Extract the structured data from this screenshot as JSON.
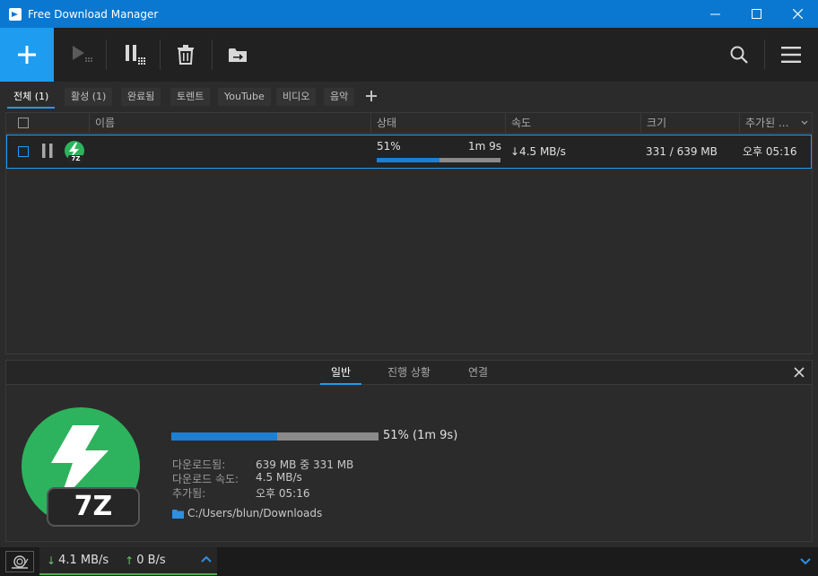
{
  "window": {
    "title": "Free Download Manager"
  },
  "tabs": [
    {
      "label": "전체 (1)",
      "active": true
    },
    {
      "label": "활성 (1)",
      "active": false
    },
    {
      "label": "완료됨",
      "active": false
    },
    {
      "label": "토렌트",
      "active": false
    },
    {
      "label": "YouTube",
      "active": false
    },
    {
      "label": "비디오",
      "active": false
    },
    {
      "label": "음악",
      "active": false
    }
  ],
  "columns": {
    "name": "이름",
    "status": "상태",
    "speed": "속도",
    "size": "크기",
    "added": "추가된 ..."
  },
  "download": {
    "name": "",
    "progress_text": "51%",
    "progress": 0.51,
    "eta": "1m 9s",
    "speed": "↓4.5 MB/s",
    "size": "331 / 639 MB",
    "added": "오후 05:16",
    "icon_label": "7Z"
  },
  "details": {
    "tabs": [
      "일반",
      "진행 상황",
      "연결"
    ],
    "progress_label": "51% (1m 9s)",
    "labels": {
      "downloaded": "다운로드됨:",
      "speed": "다운로드 속도:",
      "added": "추가됨:"
    },
    "values": {
      "downloaded": "639 MB 중 331 MB",
      "speed": "4.5 MB/s",
      "added": "오후 05:16"
    },
    "path": "C:/Users/blun/Downloads"
  },
  "statusbar": {
    "down": "4.1 MB/s",
    "up": "0 B/s"
  },
  "colors": {
    "accent": "#1e9cf0",
    "titlebar": "#0a78d0",
    "icon_green": "#2db35d",
    "status_green": "#4cae4c"
  }
}
